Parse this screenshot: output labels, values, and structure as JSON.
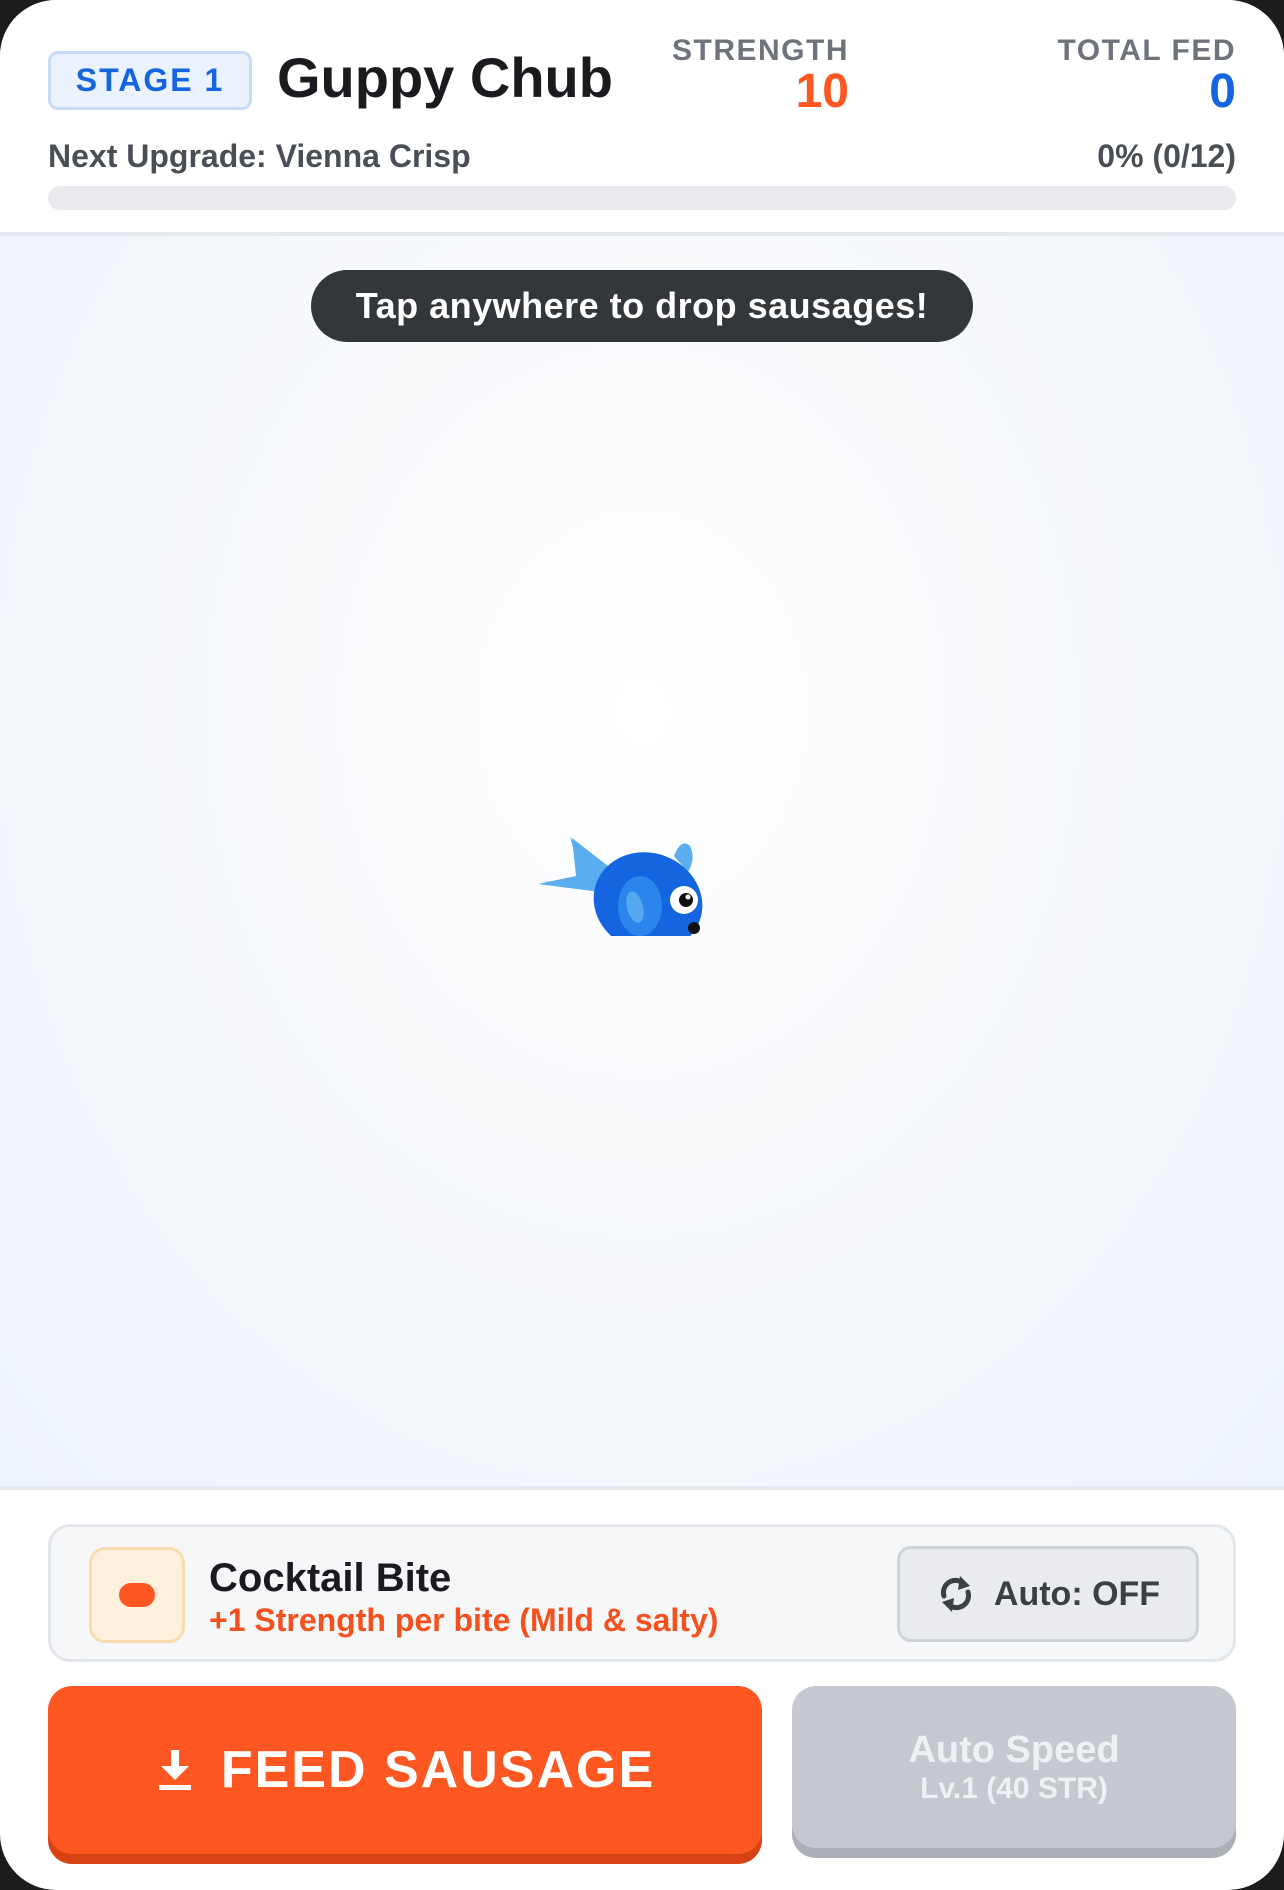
{
  "header": {
    "stage_label": "STAGE 1",
    "creature_name": "Guppy Chub",
    "strength_label": "STRENGTH",
    "strength_value": "10",
    "total_fed_label": "TOTAL FED",
    "total_fed_value": "0",
    "next_upgrade_text": "Next Upgrade: Vienna Crisp",
    "progress_text": "0% (0/12)",
    "progress_fraction": 0
  },
  "play_area": {
    "hint": "Tap anywhere to drop sausages!",
    "creature_icon": "blue-fish"
  },
  "food": {
    "icon": "sausage-icon",
    "name": "Cocktail Bite",
    "description": "+1 Strength per bite (Mild & salty)",
    "auto_toggle_label": "Auto: OFF"
  },
  "actions": {
    "feed_label": "FEED SAUSAGE",
    "speed_title": "Auto Speed",
    "speed_subtitle": "Lv.1 (40 STR)"
  },
  "colors": {
    "accent": "#ff5722",
    "stage_blue": "#1565e0",
    "fish_blue": "#1565e0",
    "disabled_button": "#c5c9cf"
  }
}
